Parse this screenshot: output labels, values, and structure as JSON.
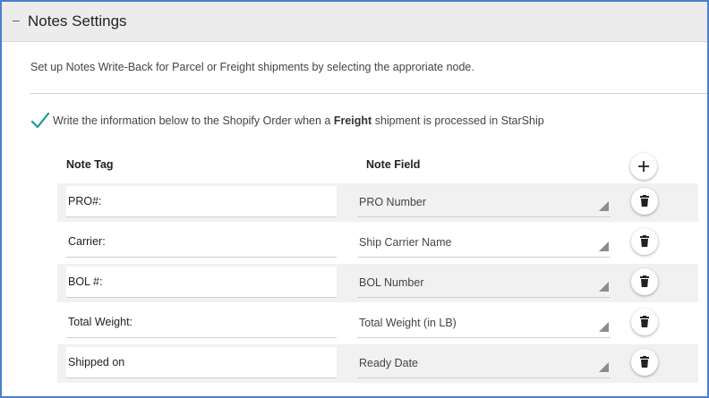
{
  "header": {
    "collapse_symbol": "–",
    "title": "Notes Settings"
  },
  "description": "Set up Notes Write-Back for Parcel or Freight shipments by selecting the approriate node.",
  "option": {
    "checked": true,
    "text_before": "Write the information below to the Shopify Order when a",
    "text_bold": "Freight",
    "text_after": "shipment is processed in StarShip"
  },
  "table": {
    "col_tag": "Note Tag",
    "col_field": "Note Field",
    "add_icon": "plus-icon",
    "delete_icon": "trash-icon",
    "rows": [
      {
        "tag": "PRO#:",
        "field": "PRO Number"
      },
      {
        "tag": "Carrier:",
        "field": "Ship Carrier Name"
      },
      {
        "tag": "BOL #:",
        "field": "BOL Number"
      },
      {
        "tag": "Total Weight:",
        "field": "Total Weight (in LB)"
      },
      {
        "tag": "Shipped on",
        "field": "Ready Date"
      }
    ]
  },
  "colors": {
    "frame_border": "#4a7fd0",
    "check": "#1a9a8c",
    "header_bg": "#ececec",
    "row_shade": "#f1f1f1"
  }
}
